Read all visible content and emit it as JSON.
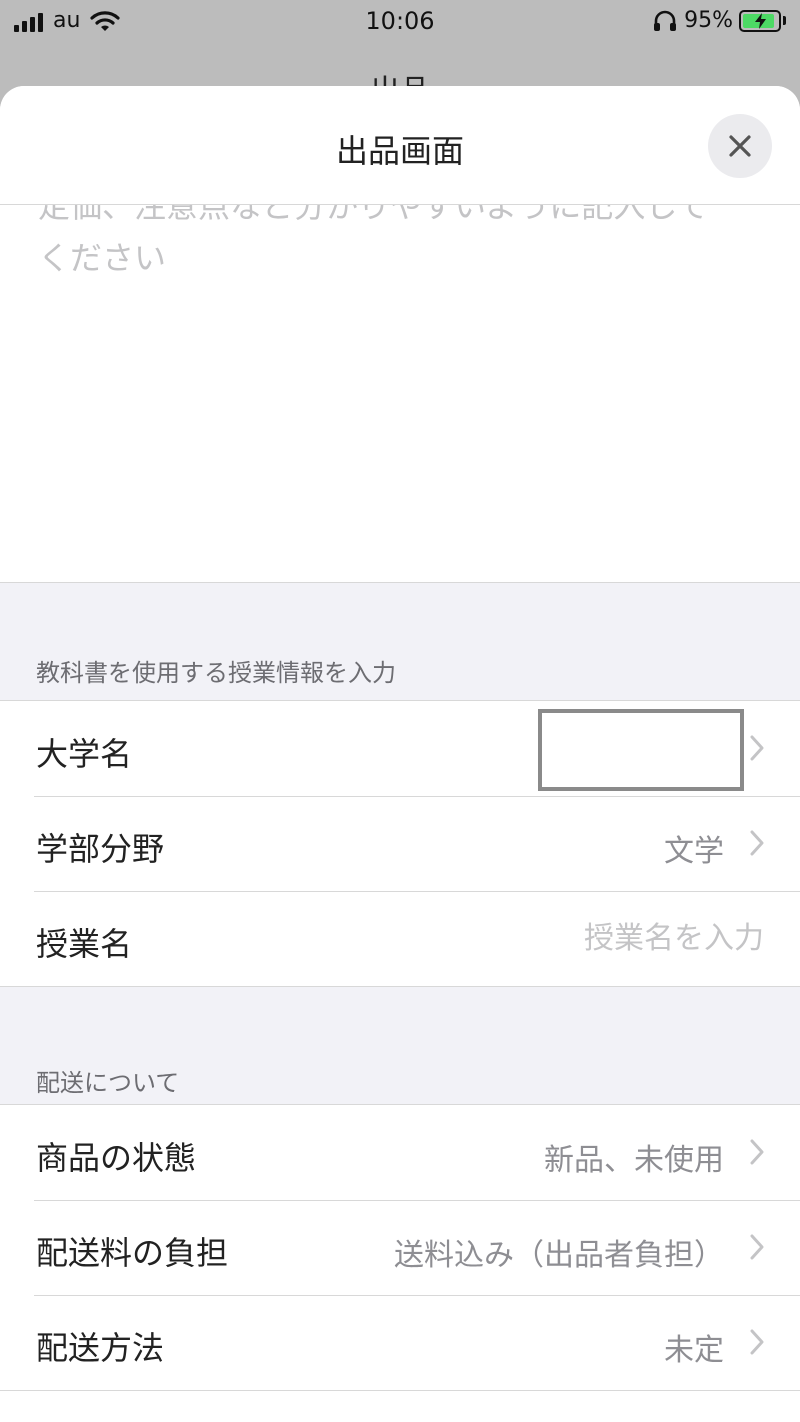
{
  "status_bar": {
    "carrier": "au",
    "time": "10:06",
    "battery_percent": "95%",
    "battery_level": 0.95,
    "charging": true,
    "icons": [
      "signal-icon",
      "wifi-icon",
      "headphones-icon",
      "battery-icon"
    ]
  },
  "background_title": "出品",
  "sheet": {
    "title": "出品画面",
    "close_icon": "close-icon",
    "description_placeholder_line1": "定価、注意点など分かりやすいように記入して",
    "description_placeholder_line2": "ください"
  },
  "class_section": {
    "header": "教科書を使用する授業情報を入力",
    "rows": [
      {
        "label": "大学名",
        "value": ""
      },
      {
        "label": "学部分野",
        "value": "文学"
      },
      {
        "label": "授業名",
        "placeholder": "授業名を入力"
      }
    ]
  },
  "shipping_section": {
    "header": "配送について",
    "rows": [
      {
        "label": "商品の状態",
        "value": "新品、未使用"
      },
      {
        "label": "配送料の負担",
        "value": "送料込み（出品者負担）"
      },
      {
        "label": "配送方法",
        "value": "未定"
      }
    ]
  },
  "colors": {
    "section_bg": "#f2f2f7",
    "secondary_text": "#8e8e93",
    "placeholder_text": "#c4c4c6",
    "battery_fill": "#4cd964"
  }
}
